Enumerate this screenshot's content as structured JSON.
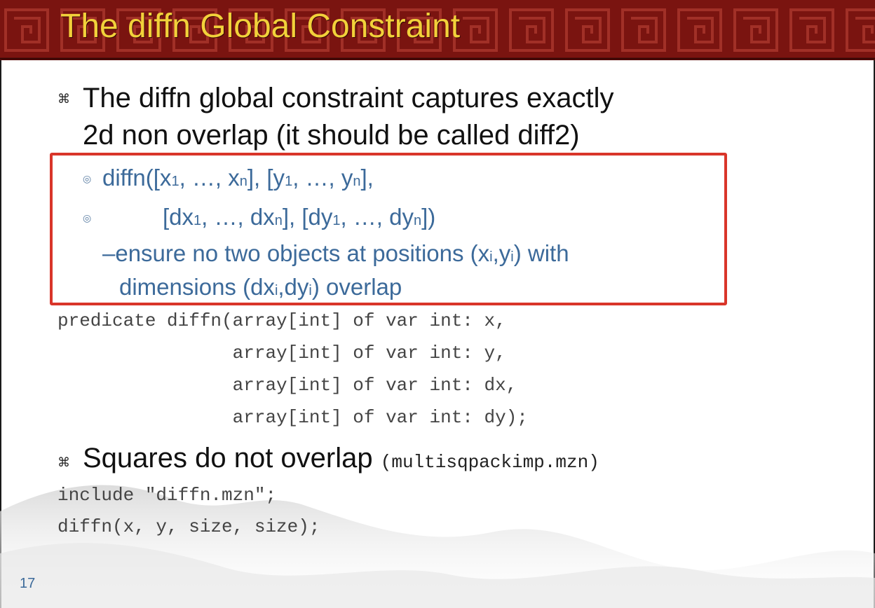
{
  "title": "The diffn Global Constraint",
  "bullets": {
    "main1_line1": "The diffn global constraint captures exactly",
    "main1_line2": "2d non overlap (it should be called diff2)",
    "main2": "Squares do not overlap",
    "main2_file": "(multisqpackimp.mzn)"
  },
  "subpoints": {
    "sig1": {
      "a": "diffn([x",
      "i1": "1",
      "b": ", …, x",
      "in": "n",
      "c": "], [y",
      "i2": "1",
      "d": ", …, y",
      "in2": "n",
      "e": "],"
    },
    "sig2": {
      "a": "[dx",
      "i1": "1",
      "b": ", …, dx",
      "in": "n",
      "c": "], [dy",
      "i2": "1",
      "d": ", …, dy",
      "in2": "n",
      "e": "])"
    },
    "desc": {
      "a": "–ensure no two objects at positions (x",
      "i1": "i",
      "b": ",y",
      "i2": "i",
      "c": ") with",
      "d": "dimensions (dx",
      "i3": "i",
      "e": ",dy",
      "i4": "i",
      "f": ") overlap"
    }
  },
  "code_predicate": [
    "predicate diffn(array[int] of var int: x,",
    "                array[int] of var int: y,",
    "                array[int] of var int: dx,",
    "                array[int] of var int: dy);"
  ],
  "code_usage": [
    "include \"diffn.mzn\";",
    "diffn(x, y, size, size);"
  ],
  "slide_number": "17",
  "icons": {
    "bullet": "⌘",
    "sub_bullet": "◎"
  },
  "colors": {
    "banner": "#7a1410",
    "title": "#f2d13a",
    "subtext": "#3c6a9a",
    "box": "#d9352a"
  }
}
